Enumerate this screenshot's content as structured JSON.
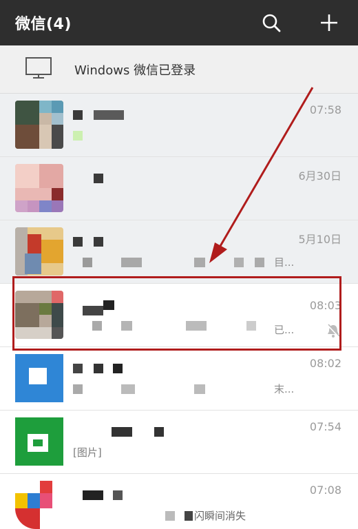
{
  "header": {
    "title": "微信(4)",
    "search_icon": "search-icon",
    "add_icon": "plus-icon",
    "background": "#2e2e2e"
  },
  "banner": {
    "icon": "desktop-monitor-icon",
    "text": "Windows 微信已登录"
  },
  "chats": [
    {
      "time": "07:58",
      "snippet": ""
    },
    {
      "time": "6月30日",
      "snippet": ""
    },
    {
      "time": "5月10日",
      "snippet": "目..."
    },
    {
      "time": "08:03",
      "snippet": "已...",
      "muted": true,
      "highlighted": true
    },
    {
      "time": "08:02",
      "snippet": "末..."
    },
    {
      "time": "07:54",
      "snippet": "[图片]"
    },
    {
      "time": "07:08",
      "snippet": "闪瞬间消失"
    }
  ],
  "annotation": {
    "highlight_color": "#b01c1c"
  }
}
